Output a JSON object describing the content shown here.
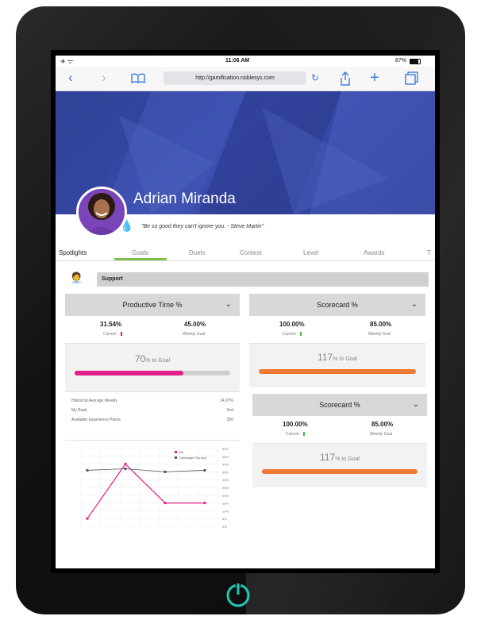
{
  "status_bar": {
    "time": "11:06 AM",
    "battery": "87%"
  },
  "browser": {
    "url": "http://gamification.noblesys.com"
  },
  "profile": {
    "name": "Adrian Miranda",
    "quote": "\"Be so good they can't ignore you.  - Steve Martin\""
  },
  "tabs": [
    {
      "label": "Spotlights"
    },
    {
      "label": "Goals",
      "active": true
    },
    {
      "label": "Duels"
    },
    {
      "label": "Contest"
    },
    {
      "label": "Level"
    },
    {
      "label": "Awards"
    },
    {
      "label": "T"
    }
  ],
  "team": {
    "label": "Support"
  },
  "productive": {
    "title": "Productive Time %",
    "current_value": "31.54%",
    "current_label": "Current",
    "goal_value": "45.00%",
    "goal_label": "Weekly Goal",
    "to_goal_number": "70",
    "to_goal_suffix": "% to Goal",
    "progress_fraction": 0.7,
    "bar_color": "#e0218a",
    "info": [
      {
        "label": "Historical Average Weekly",
        "value": "14.07%"
      },
      {
        "label": "My Rank",
        "value": "2nd"
      },
      {
        "label": "Available Experience Points",
        "value": "350"
      }
    ]
  },
  "scorecard_1": {
    "title": "Scorecard %",
    "current_value": "100.00%",
    "current_label": "Current",
    "goal_value": "85.00%",
    "goal_label": "Weekly Goal",
    "to_goal_number": "117",
    "to_goal_suffix": "% to Goal",
    "progress_fraction": 1.0,
    "bar_color": "#ef7a33"
  },
  "scorecard_2": {
    "title": "Scorecard %",
    "current_value": "100.00%",
    "current_label": "Current",
    "goal_value": "85.00%",
    "goal_label": "Weekly Goal",
    "to_goal_number": "117",
    "to_goal_suffix": "% to Goal",
    "progress_fraction": 1.0,
    "bar_color": "#ef7a33"
  },
  "chart_data": {
    "type": "line",
    "series": [
      {
        "name": "Me",
        "color": "#e0218a",
        "values": [
          5,
          40,
          15,
          15
        ]
      },
      {
        "name": "Campaign Grp Avg",
        "color": "#555555",
        "values": [
          36,
          37,
          35,
          36
        ]
      }
    ],
    "y_ticks": [
      "50%",
      "45%",
      "40%",
      "35%",
      "30%",
      "25%",
      "20%",
      "15%",
      "10%",
      "5%",
      "0%"
    ],
    "ylim": [
      0,
      50
    ]
  },
  "colors": {
    "accent_green": "#7fc24a",
    "banner": "#2f3f95",
    "link_blue": "#3b7ddd"
  }
}
